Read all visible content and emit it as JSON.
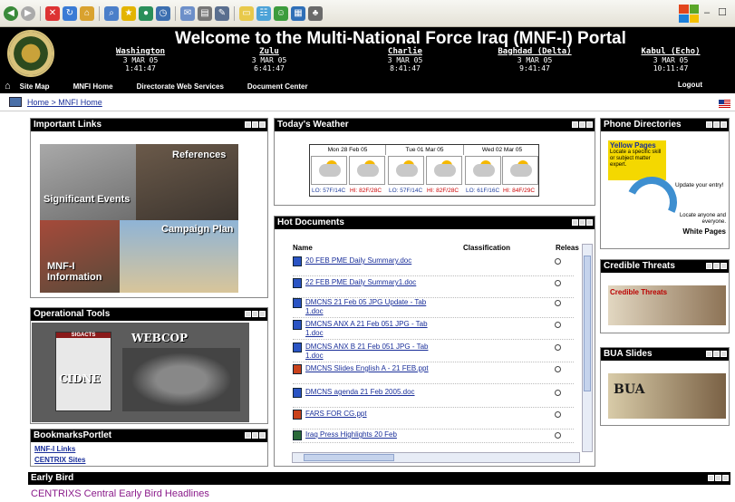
{
  "window": {
    "toolbar_icons": [
      "back-icon",
      "forward-icon",
      "stop-icon",
      "refresh-icon",
      "home-icon",
      "search-icon",
      "favorites-icon",
      "media-icon",
      "history-icon",
      "mail-icon",
      "print-icon",
      "edit-icon",
      "folder-icon",
      "discuss-icon",
      "messenger-icon",
      "research-icon"
    ]
  },
  "banner": {
    "title": "Welcome to the Multi-National Force Iraq (MNF-I) Portal",
    "clocks": [
      {
        "city": "Washington",
        "date": "3 MAR 05",
        "time": "1:41:47"
      },
      {
        "city": "Zulu",
        "date": "3 MAR 05",
        "time": "6:41:47"
      },
      {
        "city": "Charlie",
        "date": "3 MAR 05",
        "time": "8:41:47"
      },
      {
        "city": "Baghdad (Delta)",
        "date": "3 MAR 05",
        "time": "9:41:47"
      },
      {
        "city": "Kabul (Echo)",
        "date": "3 MAR 05",
        "time": "10:11:47"
      }
    ]
  },
  "nav": {
    "items": [
      "Site Map",
      "MNFI Home",
      "Directorate Web Services",
      "Document Center"
    ],
    "logout": "Logout"
  },
  "breadcrumb": "Home > MNFI Home",
  "important_links": {
    "title": "Important Links",
    "labels": [
      "References",
      "Significant Events",
      "Campaign Plan",
      "MNF-I Information"
    ]
  },
  "operational_tools": {
    "title": "Operational Tools",
    "labels": [
      "SIGACTS",
      "WEBCOP",
      "CIDNE"
    ]
  },
  "bookmarks": {
    "title": "BookmarksPortlet",
    "links": [
      "MNF-I Links",
      "CENTRIX Sites"
    ]
  },
  "weather": {
    "title": "Today's Weather",
    "days": [
      "Mon 28 Feb 05",
      "Tue 01 Mar 05",
      "Wed 02 Mar 05"
    ],
    "lows": [
      "LO: 57F/14C",
      "LO: 57F/14C",
      "LO: 61F/16C"
    ],
    "highs": [
      "HI: 82F/28C",
      "HI: 82F/28C",
      "HI: 84F/29C"
    ]
  },
  "hot_documents": {
    "title": "Hot Documents",
    "columns": [
      "Name",
      "Classification",
      "Releas"
    ],
    "docs": [
      "20 FEB PME Daily Summary.doc",
      "22 FEB PME Daily Summary1.doc",
      "DMCNS 21 Feb 05 JPG Update - Tab 1.doc",
      "DMCNS ANX A 21 Feb 051 JPG - Tab 1.doc",
      "DMCNS ANX B 21 Feb 051 JPG - Tab 1.doc",
      "DMCNS Slides English A - 21 FEB.ppt",
      "DMCNS agenda 21 Feb 2005.doc",
      "FARS FOR CG.ppt",
      "Iraq Press Highlights 20 Feb"
    ]
  },
  "phone_directories": {
    "title": "Phone Directories",
    "yellow": "Yellow Pages",
    "yellow_text": "Locate a specific skill or subject matter expert.",
    "update": "Update your entry!",
    "white_text": "Locate anyone and everyone.",
    "white": "White Pages"
  },
  "credible_threats": {
    "title": "Credible Threats",
    "label": "Credible Threats"
  },
  "bua_slides": {
    "title": "BUA Slides",
    "label": "BUA"
  },
  "early_bird": {
    "title": "Early Bird",
    "headline": "CENTRIXS Central Early Bird Headlines"
  }
}
